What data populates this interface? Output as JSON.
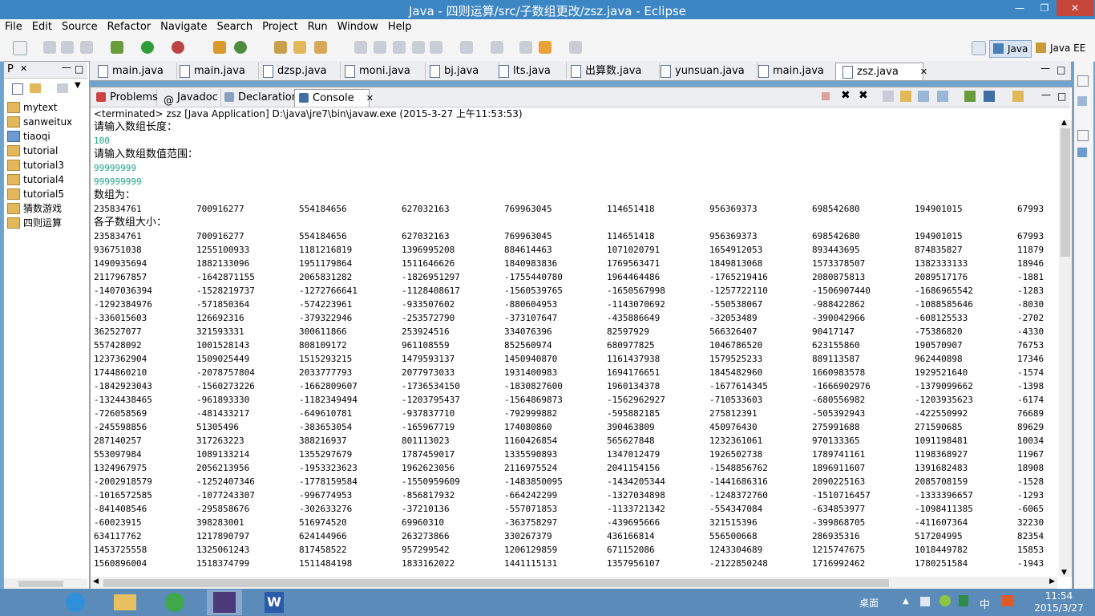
{
  "window": {
    "title": "Java - 四则运算/src/子数组更改/zsz.java - Eclipse"
  },
  "menu": [
    "File",
    "Edit",
    "Source",
    "Refactor",
    "Navigate",
    "Search",
    "Project",
    "Run",
    "Window",
    "Help"
  ],
  "perspectives": {
    "java": "Java",
    "javaee": "Java EE"
  },
  "package_explorer": {
    "tab": "P",
    "items": [
      "mytext",
      "sanweitux",
      "tiaoqi",
      "tutorial",
      "tutorial3",
      "tutorial4",
      "tutorial5",
      "猜数游戏",
      "四则运算"
    ]
  },
  "editor_tabs": [
    "main.java",
    "main.java",
    "dzsp.java",
    "moni.java",
    "bj.java",
    "lts.java",
    "出算数.java",
    "yunsuan.java",
    "main.java",
    "zsz.java"
  ],
  "view_tabs": [
    "Problems",
    "Javadoc",
    "Declaration",
    "Console"
  ],
  "console": {
    "terminated": "<terminated> zsz [Java Application] D:\\java\\jre7\\bin\\javaw.exe (2015-3-27 上午11:53:53)",
    "prompt_length": "请输入数组长度：",
    "input_length": "100",
    "prompt_range": "请输入数组数值范围：",
    "input_range_1": "99999999",
    "input_range_2": "999999999",
    "array_label": "数组为：",
    "array_row": [
      "235834761",
      "700916277",
      "554184656",
      "627032163",
      "769963045",
      "114651418",
      "956369373",
      "698542680",
      "194901015",
      "67993"
    ],
    "sizes_label": "各子数组大小：",
    "size_rows": [
      [
        "235834761",
        "700916277",
        "554184656",
        "627032163",
        "769963045",
        "114651418",
        "956369373",
        "698542680",
        "194901015",
        "67993"
      ],
      [
        "936751038",
        "1255100933",
        "1181216819",
        "1396995208",
        "884614463",
        "1071020791",
        "1654912053",
        "893443695",
        "874835827",
        "11879"
      ],
      [
        "1490935694",
        "1882133096",
        "1951179864",
        "1511646626",
        "1840983836",
        "1769563471",
        "1849813068",
        "1573378507",
        "1382333133",
        "18946"
      ],
      [
        "2117967857",
        "-1642871155",
        "2065831282",
        "-1826951297",
        "-1755440780",
        "1964464486",
        "-1765219416",
        "2080875813",
        "2089517176",
        "-1881"
      ],
      [
        "-1407036394",
        "-1528219737",
        "-1272766641",
        "-1128408617",
        "-1560539765",
        "-1650567998",
        "-1257722110",
        "-1506907440",
        "-1686965542",
        "-1283"
      ],
      [
        "-1292384976",
        "-571850364",
        "-574223961",
        "-933507602",
        "-880604953",
        "-1143070692",
        "-550538067",
        "-988422862",
        "-1088585646",
        "-8030"
      ],
      [
        "-336015603",
        "126692316",
        "-379322946",
        "-253572790",
        "-373107647",
        "-435886649",
        "-32053489",
        "-390042966",
        "-608125533",
        "-2702"
      ],
      [
        "362527077",
        "321593331",
        "300611866",
        "253924516",
        "334076396",
        "82597929",
        "566326407",
        "90417147",
        "-75386820",
        "-4330"
      ],
      [
        "557428092",
        "1001528143",
        "808109172",
        "961108559",
        "852560974",
        "680977825",
        "1046786520",
        "623155860",
        "190570907",
        "76753"
      ],
      [
        "1237362904",
        "1509025449",
        "1515293215",
        "1479593137",
        "1450940870",
        "1161437938",
        "1579525233",
        "889113587",
        "962440898",
        "17346"
      ],
      [
        "1744860210",
        "-2078757804",
        "2033777793",
        "2077973033",
        "1931400983",
        "1694176651",
        "1845482960",
        "1660983578",
        "1929521640",
        "-1574"
      ],
      [
        "-1842923043",
        "-1560273226",
        "-1662809607",
        "-1736534150",
        "-1830827600",
        "1960134378",
        "-1677614345",
        "-1666902976",
        "-1379099662",
        "-1398"
      ],
      [
        "-1324438465",
        "-961893330",
        "-1182349494",
        "-1203795437",
        "-1564869873",
        "-1562962927",
        "-710533603",
        "-680556982",
        "-1203935623",
        "-6174"
      ],
      [
        "-726058569",
        "-481433217",
        "-649610781",
        "-937837710",
        "-792999882",
        "-595882185",
        "275812391",
        "-505392943",
        "-422550992",
        "76689"
      ],
      [
        "-245598856",
        "51305496",
        "-383653054",
        "-165967719",
        "174080860",
        "390463809",
        "450976430",
        "275991688",
        "271590685",
        "89629"
      ],
      [
        "287140257",
        "317263223",
        "388216937",
        "801113023",
        "1160426854",
        "565627848",
        "1232361061",
        "970133365",
        "1091198481",
        "10034"
      ],
      [
        "553097984",
        "1089133214",
        "1355297679",
        "1787459017",
        "1335590893",
        "1347012479",
        "1926502738",
        "1789741161",
        "1198368927",
        "11967"
      ],
      [
        "1324967975",
        "2056213956",
        "-1953323623",
        "1962623056",
        "2116975524",
        "2041154156",
        "-1548856762",
        "1896911607",
        "1391682483",
        "18908"
      ],
      [
        "-2002918579",
        "-1252407346",
        "-1778159584",
        "-1550959609",
        "-1483850095",
        "-1434205344",
        "-1441686316",
        "2090225163",
        "2085708159",
        "-1528"
      ],
      [
        "-1016572585",
        "-1077243307",
        "-996774953",
        "-856817932",
        "-664242299",
        "-1327034898",
        "-1248372760",
        "-1510716457",
        "-1333396657",
        "-1293"
      ],
      [
        "-841408546",
        "-295858676",
        "-302633276",
        "-37210136",
        "-557071853",
        "-1133721342",
        "-554347084",
        "-634853977",
        "-1098411385",
        "-6065"
      ],
      [
        "-60023915",
        "398283001",
        "516974520",
        "69960310",
        "-363758297",
        "-439695666",
        "321515396",
        "-399868705",
        "-411607364",
        "32230"
      ],
      [
        "634117762",
        "1217890797",
        "624144966",
        "263273866",
        "330267379",
        "436166814",
        "556500668",
        "286935316",
        "517204995",
        "82354"
      ],
      [
        "1453725558",
        "1325061243",
        "817458522",
        "957299542",
        "1206129859",
        "671152086",
        "1243304689",
        "1215747675",
        "1018449782",
        "15853"
      ],
      [
        "1560896004",
        "1518374799",
        "1511484198",
        "1833162022",
        "1441115131",
        "1357956107",
        "-2122850248",
        "1716992462",
        "1780251584",
        "-1943"
      ]
    ]
  },
  "taskbar": {
    "desktop": "桌面",
    "ime": "中",
    "time": "11:54",
    "date": "2015/3/27"
  },
  "colors": {
    "titlebar": "#3c86c4",
    "taskbar": "#5b8bb8",
    "console_input": "#1aa58a"
  }
}
